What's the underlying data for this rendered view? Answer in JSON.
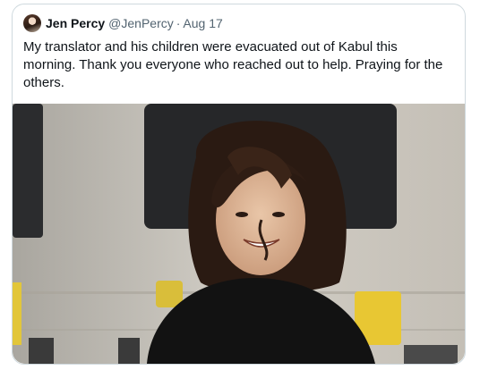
{
  "tweet": {
    "author_name": "Jen Percy",
    "handle": "@JenPercy",
    "separator": "·",
    "date": "Aug 17",
    "text": "My translator and his children were evacuated out of Kabul this morning. Thank you everyone who reached out to help. Praying for the others."
  },
  "colors": {
    "text_primary": "#0f1419",
    "text_secondary": "#536471",
    "border": "#cfd9de"
  }
}
